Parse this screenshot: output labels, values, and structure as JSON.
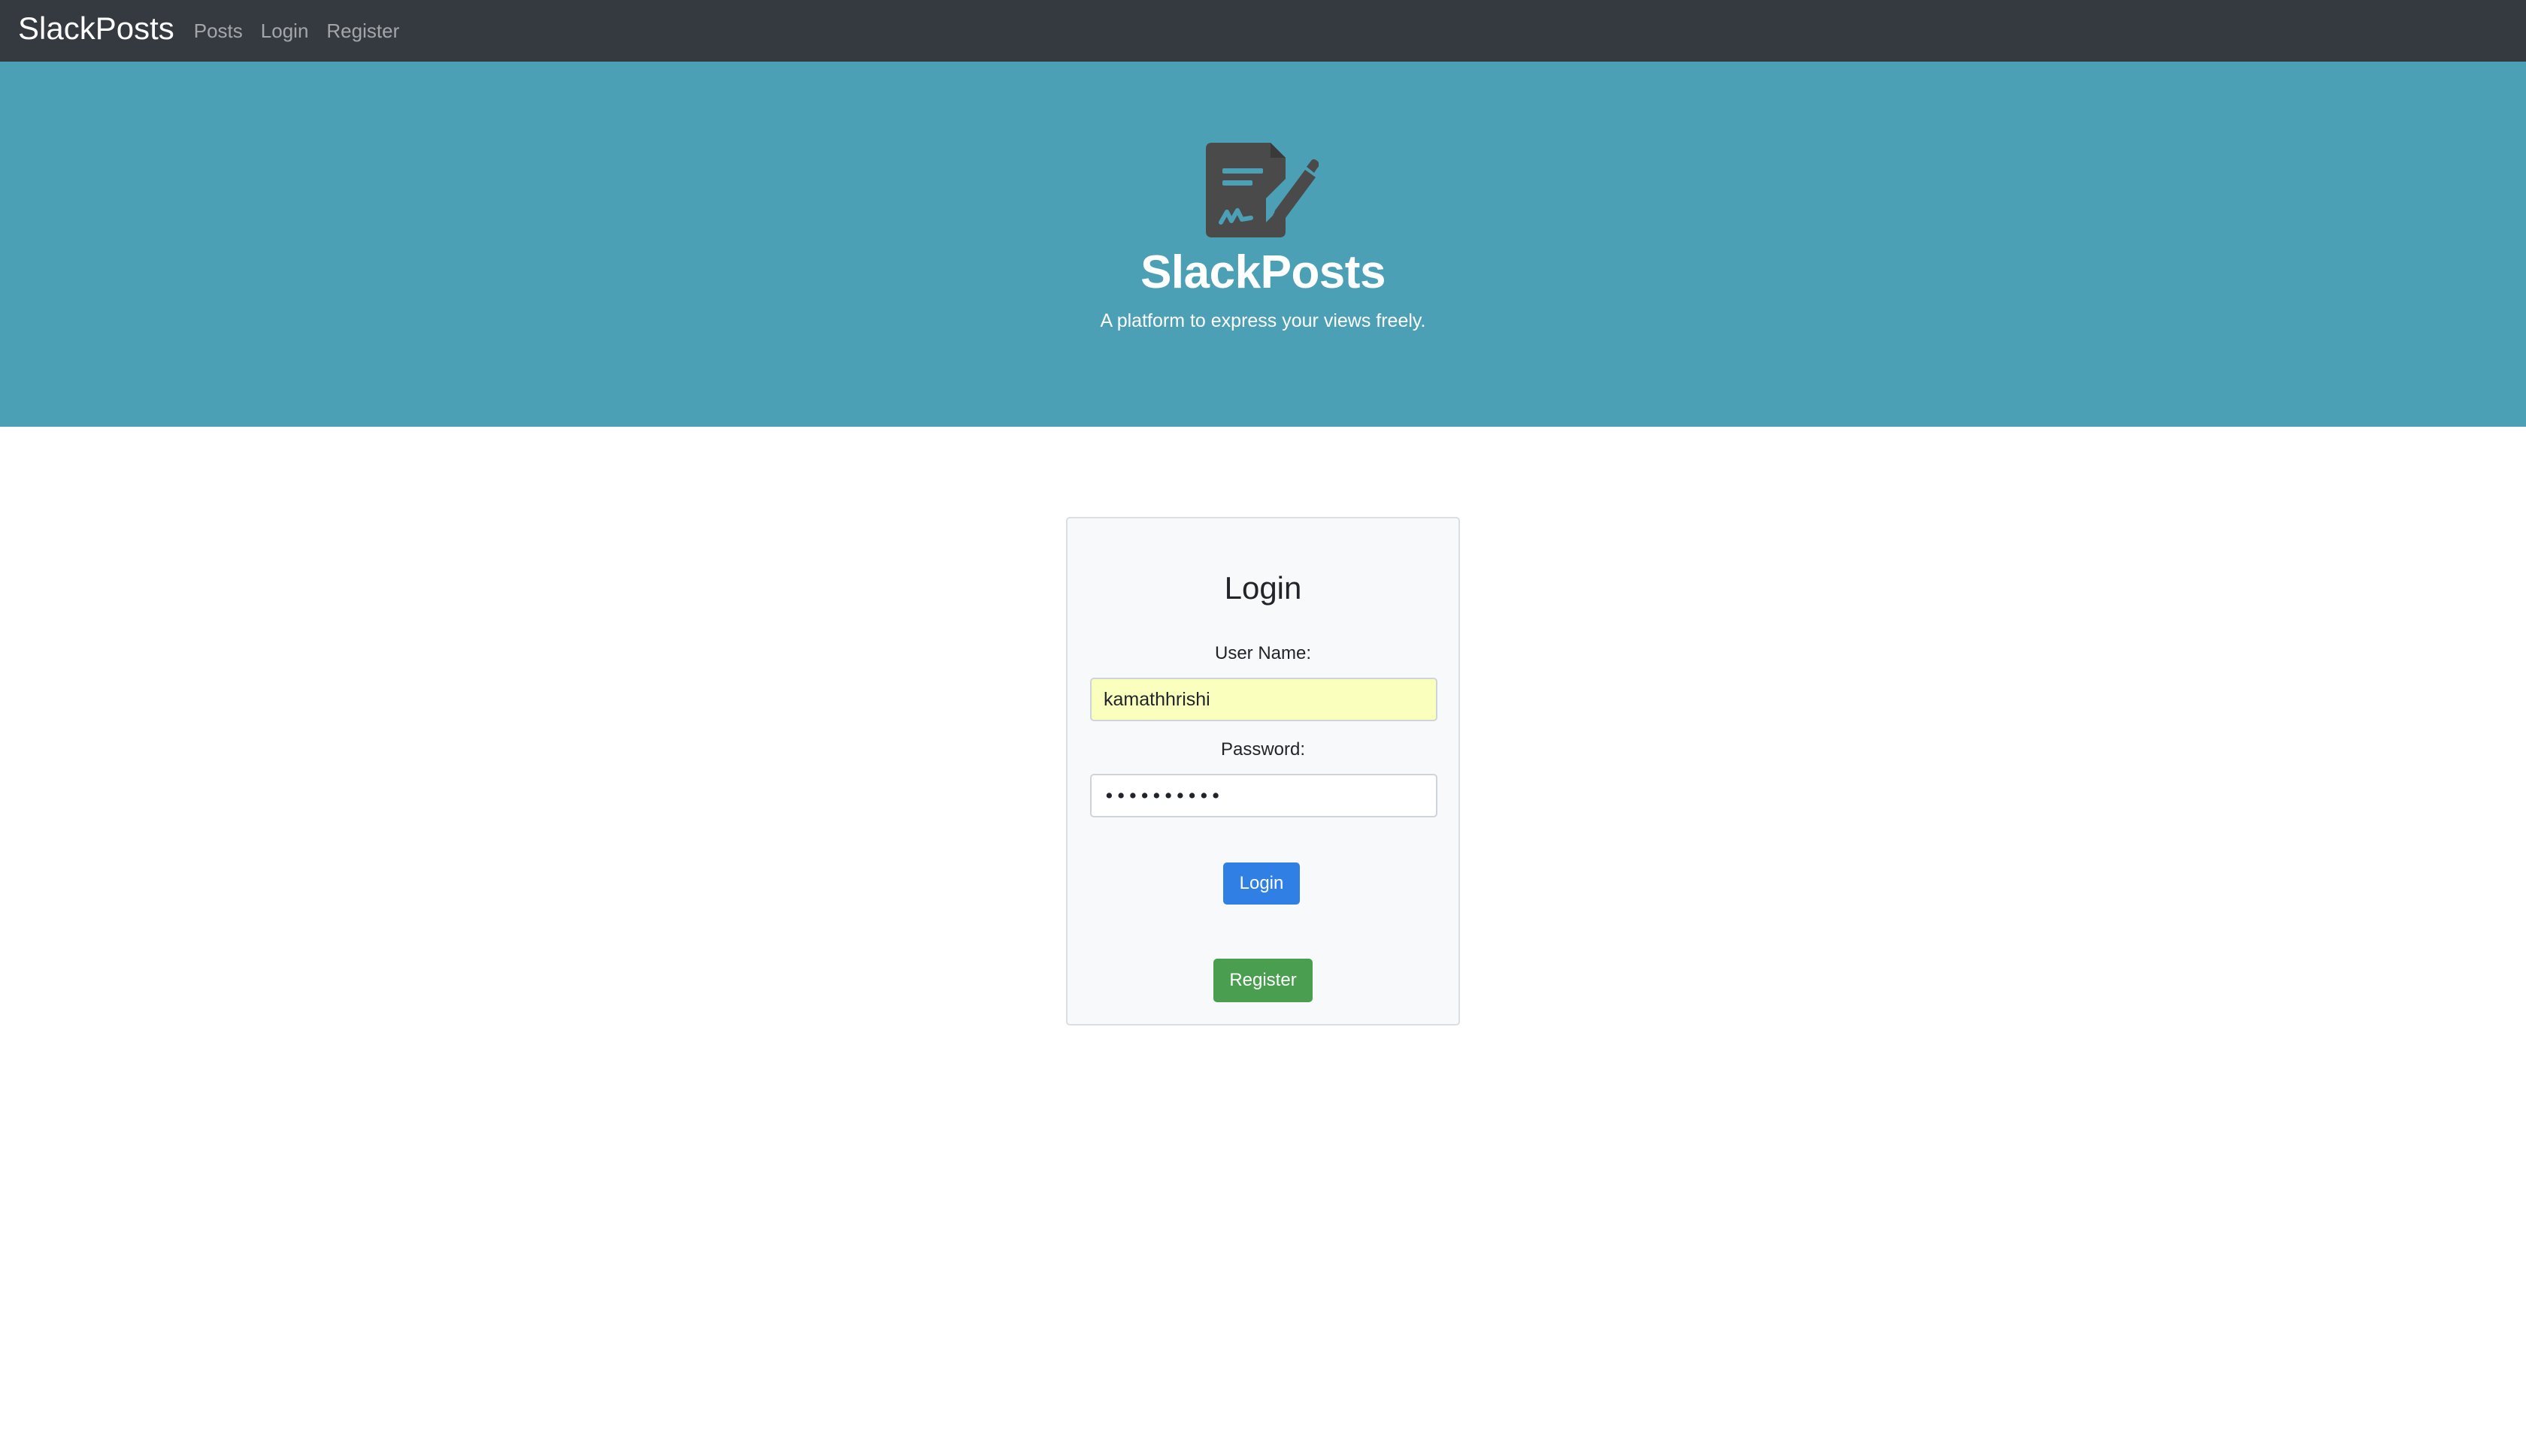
{
  "navbar": {
    "brand": "SlackPosts",
    "links": [
      "Posts",
      "Login",
      "Register"
    ]
  },
  "hero": {
    "icon": "file-signature-icon",
    "title": "SlackPosts",
    "subtitle": "A platform to express your views freely."
  },
  "login_form": {
    "title": "Login",
    "username_label": "User Name:",
    "username_value": "kamathhrishi",
    "password_label": "Password:",
    "password_value": "••••••••••",
    "login_button": "Login",
    "register_button": "Register"
  },
  "colors": {
    "navbar_bg": "#343a40",
    "hero_bg": "#4ba0b6",
    "login_button": "#2f7fe4",
    "register_button": "#4a9e4f",
    "autofill_bg": "#faffbd"
  }
}
